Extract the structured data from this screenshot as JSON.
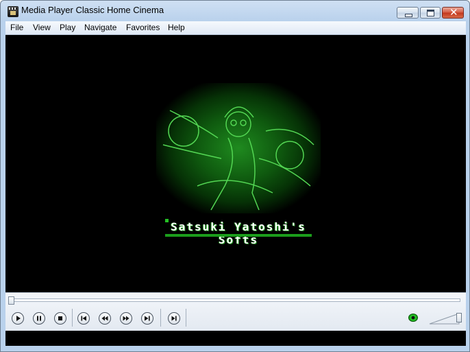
{
  "window": {
    "title": "Media Player Classic Home Cinema",
    "icon": "film-clapper-icon",
    "buttons": [
      "minimize-icon",
      "maximize-icon",
      "close-icon"
    ]
  },
  "menu": {
    "items": [
      "File",
      "View",
      "Play",
      "Navigate",
      "Favorites",
      "Help"
    ]
  },
  "video": {
    "logo_text": "Satsuki Yatoshi's Softs",
    "accent_color": "#1b9e1b"
  },
  "controls": {
    "seek_position": 0,
    "buttons": [
      "play-icon",
      "pause-icon",
      "stop-icon",
      "skip-previous-icon",
      "rewind-icon",
      "fast-forward-icon",
      "skip-next-icon",
      "frame-step-icon"
    ],
    "status_icon": "green-eye-status-icon",
    "volume_level": 1.0
  }
}
